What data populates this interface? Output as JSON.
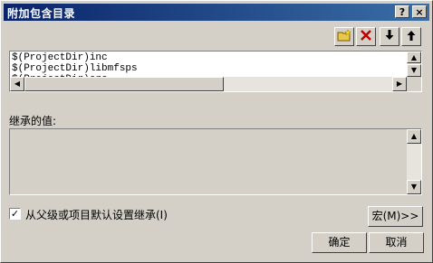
{
  "dialog": {
    "title": "附加包含目录",
    "help_label": "?",
    "close_label": "×"
  },
  "toolbar": {
    "new_icon": "new-folder-icon",
    "delete_icon": "delete-x-icon",
    "down_icon": "arrow-down-icon",
    "up_icon": "arrow-up-icon"
  },
  "list": {
    "items": [
      "$(ProjectDir)inc",
      "$(ProjectDir)libmfsps",
      "$(ProjectDir)src"
    ]
  },
  "inherited": {
    "label": "继承的值:"
  },
  "inherit_checkbox": {
    "checked": true,
    "label": "从父级或项目默认设置继承(I)"
  },
  "buttons": {
    "macros": "宏(M)>>",
    "ok": "确定",
    "cancel": "取消"
  }
}
